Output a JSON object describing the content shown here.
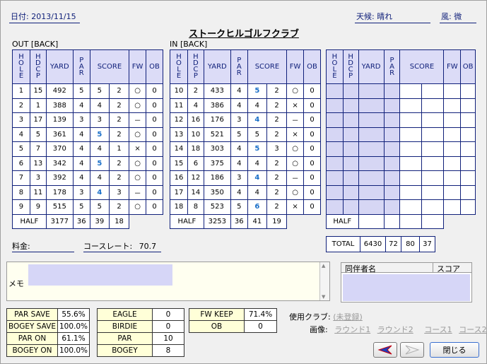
{
  "header": {
    "date": "日付: 2013/11/15",
    "weather": "天候: 晴れ",
    "wind": "風: 微",
    "course_title": "ストークヒルゴルフクラブ"
  },
  "out": {
    "label": "OUT [BACK]",
    "rows": [
      [
        "1",
        "15",
        "492",
        "5",
        "5",
        "2",
        "○",
        "0"
      ],
      [
        "2",
        "1",
        "388",
        "4",
        "4",
        "2",
        "○",
        "0"
      ],
      [
        "3",
        "17",
        "139",
        "3",
        "3",
        "2",
        "－",
        "0"
      ],
      [
        "4",
        "5",
        "361",
        "4",
        "5",
        "2",
        "○",
        "0"
      ],
      [
        "5",
        "7",
        "370",
        "4",
        "4",
        "1",
        "×",
        "0"
      ],
      [
        "6",
        "13",
        "342",
        "4",
        "5",
        "2",
        "○",
        "0"
      ],
      [
        "7",
        "3",
        "392",
        "4",
        "4",
        "2",
        "○",
        "0"
      ],
      [
        "8",
        "11",
        "178",
        "3",
        "4",
        "3",
        "－",
        "0"
      ],
      [
        "9",
        "9",
        "515",
        "5",
        "5",
        "2",
        "○",
        "0"
      ]
    ],
    "half": [
      "HALF",
      "3177",
      "36",
      "39",
      "18"
    ]
  },
  "in": {
    "label": "IN [BACK]",
    "rows": [
      [
        "10",
        "2",
        "433",
        "4",
        "5",
        "2",
        "○",
        "0"
      ],
      [
        "11",
        "4",
        "386",
        "4",
        "4",
        "2",
        "×",
        "0"
      ],
      [
        "12",
        "16",
        "176",
        "3",
        "4",
        "2",
        "－",
        "0"
      ],
      [
        "13",
        "10",
        "521",
        "5",
        "5",
        "2",
        "×",
        "0"
      ],
      [
        "14",
        "18",
        "303",
        "4",
        "5",
        "3",
        "○",
        "0"
      ],
      [
        "15",
        "6",
        "375",
        "4",
        "4",
        "2",
        "○",
        "0"
      ],
      [
        "16",
        "12",
        "186",
        "3",
        "4",
        "2",
        "－",
        "0"
      ],
      [
        "17",
        "14",
        "350",
        "4",
        "4",
        "2",
        "○",
        "0"
      ],
      [
        "18",
        "8",
        "523",
        "5",
        "6",
        "2",
        "×",
        "0"
      ]
    ],
    "half": [
      "HALF",
      "3253",
      "36",
      "41",
      "19"
    ]
  },
  "columns": {
    "hole": "HOLE",
    "hdcp": "HDCP",
    "yard": "YARD",
    "par": "PAR",
    "score": "SCORE",
    "fw": "FW",
    "ob": "OB"
  },
  "third": {
    "half": "HALF"
  },
  "total": [
    "TOTAL",
    "6430",
    "72",
    "80",
    "37"
  ],
  "fee": {
    "label": "料金:",
    "course_rate_label": "コースレート:",
    "course_rate": "70.7"
  },
  "memo": {
    "label": "メモ"
  },
  "companions": {
    "name_col": "同伴者名",
    "score_col": "スコア"
  },
  "stats": {
    "t1": [
      [
        "PAR SAVE",
        "55.6%"
      ],
      [
        "BOGEY SAVE",
        "100.0%"
      ],
      [
        "PAR ON",
        "61.1%"
      ],
      [
        "BOGEY ON",
        "100.0%"
      ]
    ],
    "t2": [
      [
        "EAGLE",
        "0"
      ],
      [
        "BIRDIE",
        "0"
      ],
      [
        "PAR",
        "10"
      ],
      [
        "BOGEY",
        "8"
      ]
    ],
    "t3": [
      [
        "FW KEEP",
        "71.4%"
      ],
      [
        "OB",
        "0"
      ]
    ]
  },
  "clubs": {
    "label": "使用クラブ:",
    "unregistered": "(未登録)",
    "image_label": "画像:",
    "round1": "ラウンド1",
    "round2": "ラウンド2",
    "course1": "コース1",
    "course2": "コース2"
  },
  "buttons": {
    "close": "閉じる"
  }
}
